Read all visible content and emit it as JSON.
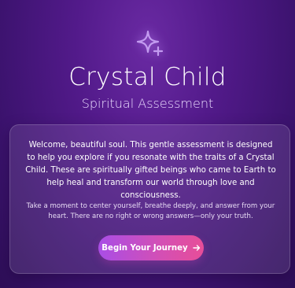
{
  "header": {
    "icon": "sparkles-icon",
    "title": "Crystal Child",
    "subtitle": "Spiritual Assessment"
  },
  "card": {
    "intro": "Welcome, beautiful soul. This gentle assessment is designed to help you explore if you resonate with the traits of a Crystal Child. These are spiritually gifted beings who came to Earth to help heal and transform our world through love and consciousness.",
    "note": "Take a moment to center yourself, breathe deeply, and answer from your heart. There are no right or wrong answers—only your truth.",
    "cta_label": "Begin Your Journey",
    "cta_icon": "arrow-right-icon"
  },
  "colors": {
    "background": "#4a1780",
    "accent_start": "#a94ee6",
    "accent_end": "#e74e98",
    "sparkle": "#c39bf0"
  }
}
